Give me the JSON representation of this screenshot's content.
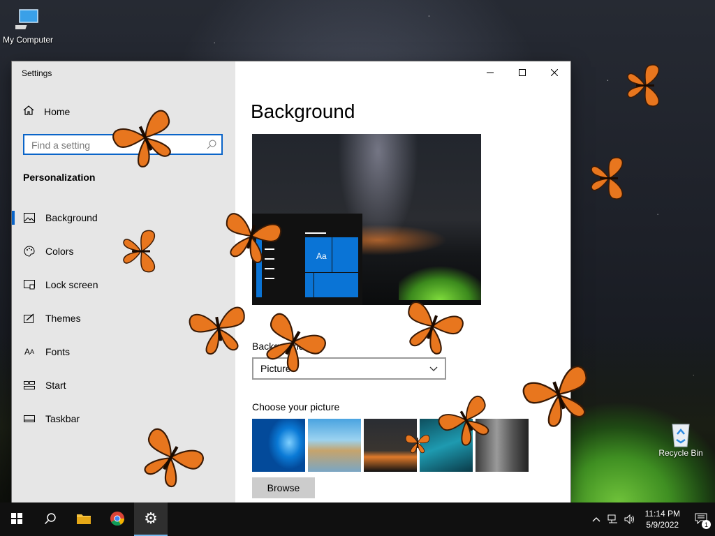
{
  "desktop": {
    "icons": [
      {
        "label": "My Computer",
        "icon": "computer-icon"
      },
      {
        "label": "Recycle Bin",
        "icon": "recycle-bin-icon"
      }
    ]
  },
  "window": {
    "title": "Settings",
    "sidebar": {
      "home_label": "Home",
      "search_placeholder": "Find a setting",
      "section_heading": "Personalization",
      "items": [
        {
          "label": "Background",
          "icon": "picture-icon",
          "active": true
        },
        {
          "label": "Colors",
          "icon": "palette-icon"
        },
        {
          "label": "Lock screen",
          "icon": "lock-screen-icon"
        },
        {
          "label": "Themes",
          "icon": "themes-icon"
        },
        {
          "label": "Fonts",
          "icon": "fonts-icon"
        },
        {
          "label": "Start",
          "icon": "start-icon"
        },
        {
          "label": "Taskbar",
          "icon": "taskbar-icon"
        }
      ]
    },
    "content": {
      "title": "Background",
      "preview_tile_text": "Aa",
      "background_label": "Background",
      "background_value": "Picture",
      "choose_label": "Choose your picture",
      "browse_label": "Browse"
    }
  },
  "taskbar": {
    "pinned": [
      "start-icon",
      "search-icon",
      "file-explorer-icon",
      "chrome-icon",
      "settings-icon"
    ],
    "clock_time": "11:14 PM",
    "clock_date": "5/9/2022",
    "notification_count": "1"
  },
  "colors": {
    "accent": "#0a64c8",
    "butterfly": "#e8761e"
  }
}
